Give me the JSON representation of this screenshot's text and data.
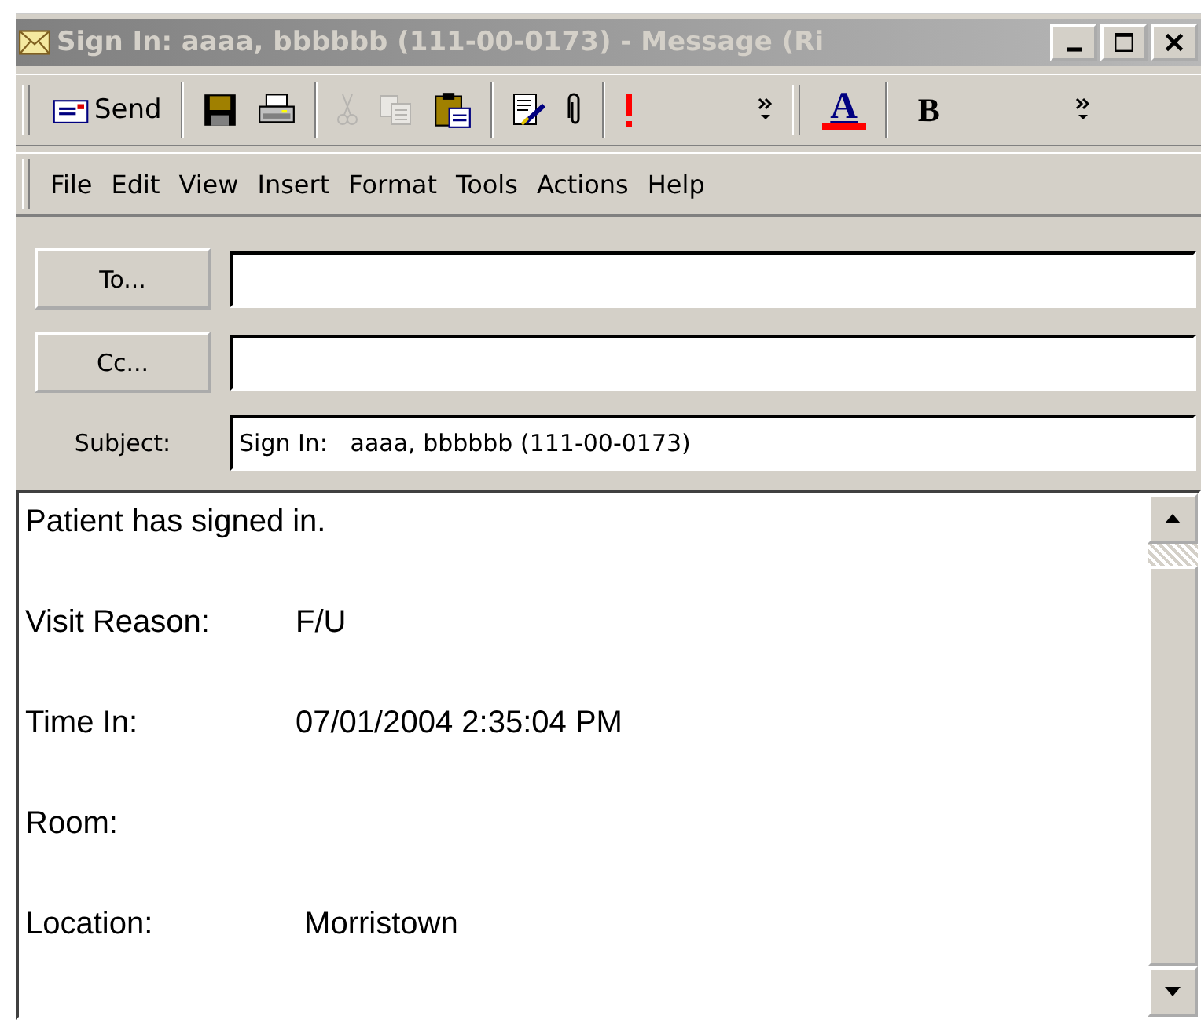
{
  "window": {
    "title": "Sign In:   aaaa, bbbbbb (111-00-0173) - Message (Ri"
  },
  "toolbar": [
    {
      "kind": "send",
      "label": "Send",
      "disabled": false
    },
    {
      "kind": "separator"
    },
    {
      "kind": "save",
      "disabled": false
    },
    {
      "kind": "print",
      "disabled": false
    },
    {
      "kind": "separator"
    },
    {
      "kind": "cut",
      "disabled": true
    },
    {
      "kind": "copy",
      "disabled": true
    },
    {
      "kind": "paste",
      "disabled": false
    },
    {
      "kind": "separator"
    },
    {
      "kind": "check",
      "disabled": false
    },
    {
      "kind": "attach",
      "disabled": false
    },
    {
      "kind": "separator"
    },
    {
      "kind": "importance",
      "disabled": false
    },
    {
      "kind": "more"
    },
    {
      "kind": "grip"
    },
    {
      "kind": "font-color",
      "label": "A",
      "disabled": false
    },
    {
      "kind": "separator"
    },
    {
      "kind": "bold",
      "label": "B",
      "disabled": false
    },
    {
      "kind": "more"
    }
  ],
  "menu": [
    "File",
    "Edit",
    "View",
    "Insert",
    "Format",
    "Tools",
    "Actions",
    "Help"
  ],
  "fields": [
    {
      "kind": "button",
      "label": "To..."
    },
    {
      "kind": "button",
      "label": "Cc..."
    },
    {
      "kind": "label",
      "label": "Subject:",
      "value": "Sign In:   aaaa, bbbbbb (111-00-0173)"
    }
  ],
  "body": [
    {
      "text": "Patient has signed in."
    },
    {
      "label": "Visit Reason:",
      "value": "F/U"
    },
    {
      "label": "Time In:",
      "value": "07/01/2004 2:35:04 PM"
    },
    {
      "label": "Room:"
    },
    {
      "label": "Location:",
      "value": " Morristown"
    }
  ]
}
